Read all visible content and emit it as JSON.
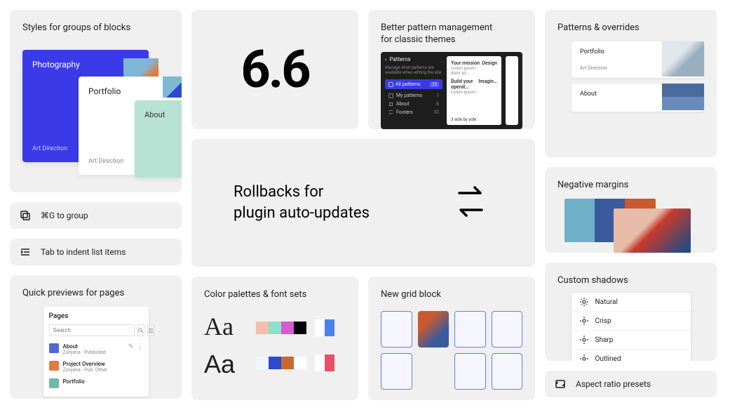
{
  "col1": {
    "styles_card": {
      "title": "Styles for groups of blocks",
      "layers": {
        "blue": {
          "label": "Photography",
          "sub": "Art Direction"
        },
        "white": {
          "label": "Portfolio",
          "sub": "Art Direction"
        },
        "mint": {
          "label": "About"
        }
      }
    },
    "tips": [
      {
        "icon": "group-icon",
        "text": "⌘G to group"
      },
      {
        "icon": "indent-icon",
        "text": "Tab to indent list items"
      }
    ],
    "previews_card": {
      "title": "Quick previews for pages",
      "panel": {
        "heading": "Pages",
        "search_placeholder": "Search",
        "items": [
          {
            "name": "About",
            "meta": "Zoryana · Published",
            "thumb": "pt-blue",
            "actions": true
          },
          {
            "name": "Project Overview",
            "meta": "Zoryana · Pub. Other",
            "thumb": "pt-orange",
            "actions": false
          },
          {
            "name": "Portfolio",
            "meta": "",
            "thumb": "pt-teal",
            "actions": false
          }
        ]
      }
    }
  },
  "mid": {
    "version": "6.6",
    "pattern_card": {
      "title": "Better pattern management\nfor classic themes",
      "dark": {
        "heading": "Patterns",
        "sub": "Manage what patterns are available when editing the site.",
        "active": {
          "label": "All patterns",
          "count": "77"
        },
        "rows": [
          {
            "label": "My patterns",
            "count": "1"
          },
          {
            "label": "About",
            "count": "6"
          },
          {
            "label": "Footers",
            "count": "10"
          }
        ],
        "preview": {
          "r1_title": "Your mission",
          "r1_right": "Design",
          "r2_title": "Build your operat…",
          "r2_right": "Imagin…",
          "footer": "3 side by side"
        }
      }
    },
    "rollback": {
      "line1": "Rollbacks for",
      "line2": "plugin auto-updates"
    },
    "palette_card": {
      "title": "Color palettes & font sets",
      "aa1": "Aa",
      "aa2": "Aa",
      "row1_colors": [
        "#f7bfa8",
        "#8fe0c8",
        "#d85ad0",
        "#000000"
      ],
      "row1_pair": [
        "#ffffff",
        "#4a82e8"
      ],
      "row2_colors": [
        "#eef6ff",
        "#2a4ad0",
        "#c86a2e",
        "#ffffff"
      ],
      "row2_pair": [
        "#ffffff",
        "#e8506a"
      ]
    },
    "grid_card": {
      "title": "New grid block"
    }
  },
  "col3": {
    "overrides_card": {
      "title": "Patterns & overrides",
      "cards": [
        {
          "name": "Portfolio",
          "meta": "Art Direction",
          "patch": "a"
        },
        {
          "name": "About",
          "meta": "",
          "patch": "b"
        }
      ]
    },
    "neg_card": {
      "title": "Negative margins"
    },
    "shadow_card": {
      "title": "Custom shadows",
      "items": [
        "Natural",
        "Crisp",
        "Sharp",
        "Outlined"
      ]
    },
    "aspect_row": {
      "icon": "aspect-icon",
      "text": "Aspect ratio presets"
    }
  }
}
